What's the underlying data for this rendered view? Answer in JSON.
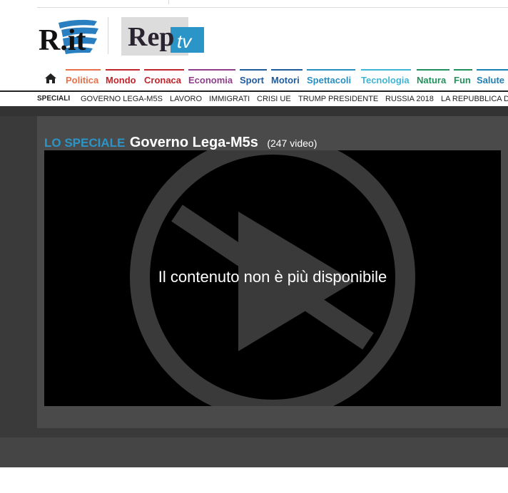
{
  "logos": {
    "rit_text": "R.it",
    "rep_text": "Rep",
    "tv_text": "tv"
  },
  "nav": {
    "home_icon": "home-icon",
    "items": [
      {
        "label": "Politica",
        "color": "#e8714b"
      },
      {
        "label": "Mondo",
        "color": "#c0262b"
      },
      {
        "label": "Cronaca",
        "color": "#c0262b"
      },
      {
        "label": "Economia",
        "color": "#8e3e8a"
      },
      {
        "label": "Sport",
        "color": "#1f5c9e"
      },
      {
        "label": "Motori",
        "color": "#1f5c9e"
      },
      {
        "label": "Spettacoli",
        "color": "#2a8fc0"
      },
      {
        "label": "Tecnologia",
        "color": "#3fb5d6"
      },
      {
        "label": "Natura",
        "color": "#21905c"
      },
      {
        "label": "Fun",
        "color": "#21905c"
      },
      {
        "label": "Salute",
        "color": "#1f7fb8"
      }
    ]
  },
  "speciali": {
    "label": "SPECIALI",
    "items": [
      "GOVERNO LEGA-M5S",
      "LAVORO",
      "IMMIGRATI",
      "CRISI UE",
      "TRUMP PRESIDENTE",
      "RUSSIA 2018",
      "LA REPUBBLICA D"
    ]
  },
  "section": {
    "kicker": "LO SPECIALE",
    "title": "Governo Lega-M5s",
    "count": "(247 video)"
  },
  "player": {
    "message": "Il contenuto non è più disponibile"
  }
}
